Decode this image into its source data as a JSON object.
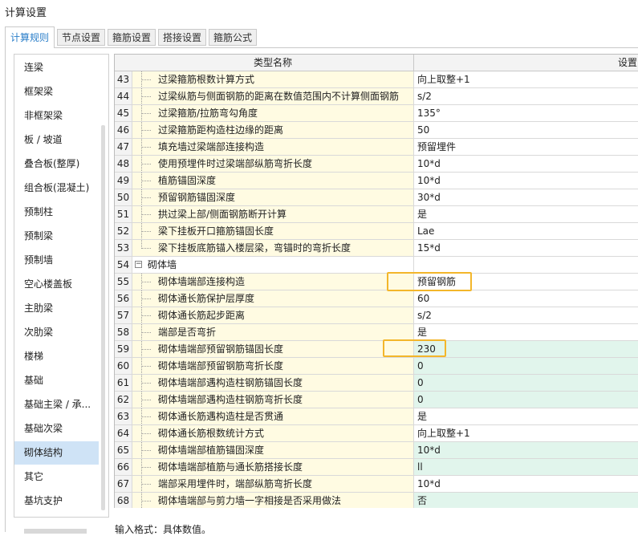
{
  "window": {
    "title": "计算设置"
  },
  "tabs": [
    {
      "label": "计算规则",
      "active": true
    },
    {
      "label": "节点设置",
      "active": false
    },
    {
      "label": "箍筋设置",
      "active": false
    },
    {
      "label": "搭接设置",
      "active": false
    },
    {
      "label": "箍筋公式",
      "active": false
    }
  ],
  "sidebar": {
    "items": [
      {
        "label": "连梁"
      },
      {
        "label": "框架梁"
      },
      {
        "label": "非框架梁"
      },
      {
        "label": "板 / 坡道"
      },
      {
        "label": "叠合板(整厚)"
      },
      {
        "label": "组合板(混凝土)"
      },
      {
        "label": "预制柱"
      },
      {
        "label": "预制梁"
      },
      {
        "label": "预制墙"
      },
      {
        "label": "空心楼盖板"
      },
      {
        "label": "主肋梁"
      },
      {
        "label": "次肋梁"
      },
      {
        "label": "楼梯"
      },
      {
        "label": "基础"
      },
      {
        "label": "基础主梁 / 承..."
      },
      {
        "label": "基础次梁"
      },
      {
        "label": "砌体结构",
        "selected": true
      },
      {
        "label": "其它"
      },
      {
        "label": "基坑支护"
      }
    ]
  },
  "table": {
    "headers": {
      "name": "类型名称",
      "value": "设置"
    },
    "rows": [
      {
        "num": "43",
        "name": "过梁箍筋根数计算方式",
        "value": "向上取整+1"
      },
      {
        "num": "44",
        "name": "过梁纵筋与侧面钢筋的距离在数值范围内不计算侧面钢筋",
        "value": "s/2"
      },
      {
        "num": "45",
        "name": "过梁箍筋/拉筋弯勾角度",
        "value": "135°"
      },
      {
        "num": "46",
        "name": "过梁箍筋距构造柱边缘的距离",
        "value": "50"
      },
      {
        "num": "47",
        "name": "填充墙过梁端部连接构造",
        "value": "预留埋件"
      },
      {
        "num": "48",
        "name": "使用预埋件时过梁端部纵筋弯折长度",
        "value": "10*d"
      },
      {
        "num": "49",
        "name": "植筋锚固深度",
        "value": "10*d"
      },
      {
        "num": "50",
        "name": "预留钢筋锚固深度",
        "value": "30*d"
      },
      {
        "num": "51",
        "name": "拱过梁上部/侧面钢筋断开计算",
        "value": "是"
      },
      {
        "num": "52",
        "name": "梁下挂板开口箍筋锚固长度",
        "value": "Lae"
      },
      {
        "num": "53",
        "name": "梁下挂板底筋锚入楼层梁，弯锚时的弯折长度",
        "value": "15*d",
        "last": true
      },
      {
        "num": "54",
        "name": "砌体墙",
        "value": "",
        "group": true,
        "expander": "−"
      },
      {
        "num": "55",
        "name": "砌体墙端部连接构造",
        "value": "预留钢筋"
      },
      {
        "num": "56",
        "name": "砌体通长筋保护层厚度",
        "value": "60"
      },
      {
        "num": "57",
        "name": "砌体通长筋起步距离",
        "value": "s/2"
      },
      {
        "num": "58",
        "name": "端部是否弯折",
        "value": "是"
      },
      {
        "num": "59",
        "name": "砌体墙端部预留钢筋锚固长度",
        "value": "230",
        "green": true
      },
      {
        "num": "60",
        "name": "砌体墙端部预留钢筋弯折长度",
        "value": "0",
        "green": true
      },
      {
        "num": "61",
        "name": "砌体墙端部遇构造柱钢筋锚固长度",
        "value": "0",
        "green": true
      },
      {
        "num": "62",
        "name": "砌体墙端部遇构造柱钢筋弯折长度",
        "value": "0",
        "green": true
      },
      {
        "num": "63",
        "name": "砌体通长筋遇构造柱是否贯通",
        "value": "是"
      },
      {
        "num": "64",
        "name": "砌体通长筋根数统计方式",
        "value": "向上取整+1"
      },
      {
        "num": "65",
        "name": "砌体墙端部植筋锚固深度",
        "value": "10*d",
        "green": true
      },
      {
        "num": "66",
        "name": "砌体墙端部植筋与通长筋搭接长度",
        "value": "ll",
        "green": true
      },
      {
        "num": "67",
        "name": "端部采用埋件时，端部纵筋弯折长度",
        "value": "10*d"
      },
      {
        "num": "68",
        "name": "砌体墙端部与剪力墙一字相接是否采用做法",
        "value": "否",
        "green": true
      }
    ]
  },
  "footer": {
    "hint": "输入格式：具体数值。"
  },
  "colors": {
    "accent": "#2a7ec9",
    "highlight": "#f3b62b",
    "name_bg": "#fffbe2",
    "green_bg": "#e1f5ec",
    "selected_bg": "#cfe3f6"
  }
}
